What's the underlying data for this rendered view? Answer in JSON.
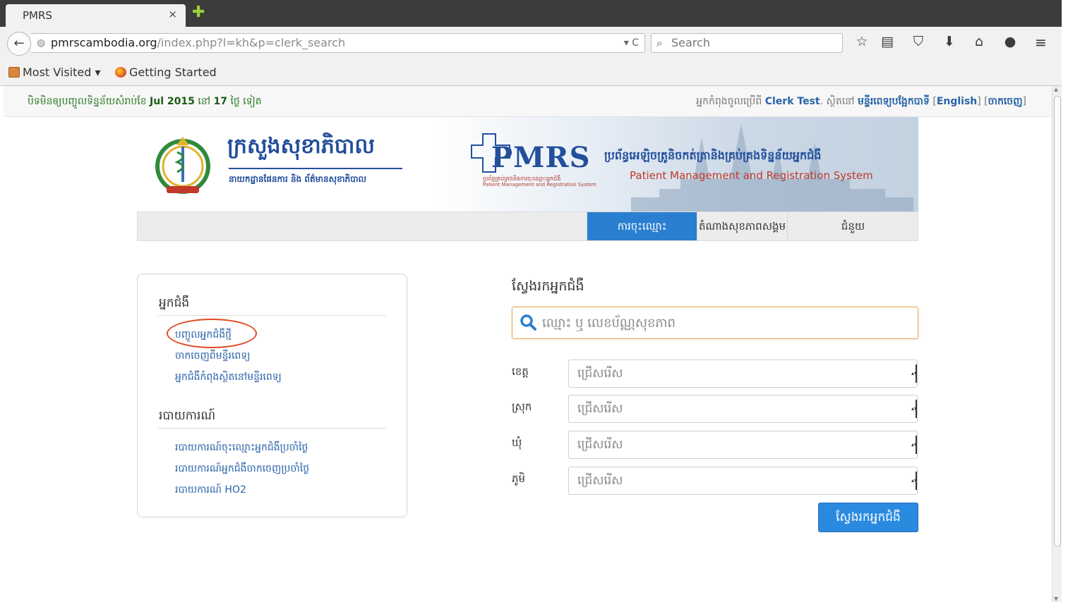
{
  "browser": {
    "tab_title": "PMRS",
    "tab_close": "×",
    "new_tab": "✚",
    "url_host": "pmrscambodia.org",
    "url_path": "/index.php?l=kh&p=clerk_search",
    "url_controls": "▾ C",
    "search_placeholder": "Search",
    "bookmarks": [
      {
        "label": "Most Visited ▾",
        "icon": "folder-icon"
      },
      {
        "label": "Getting Started",
        "icon": "firefox-icon"
      }
    ]
  },
  "topbar": {
    "notice_prefix": "បិទមិនឲ្យបញ្ចូលទិន្នន័យសំរាប់ខែ",
    "notice_month": "Jul 2015",
    "notice_mid": "នៅ",
    "notice_days": "17",
    "notice_suffix": "ថ្ងៃ ទៀត",
    "user_prefix": "អ្នកកំពុងចូលប្រើពី",
    "user_name": "Clerk Test",
    "user_mid": ". ស្ថិតនៅ",
    "hospital": "មន្ទីរពេទ្យបង្អែកបាទី",
    "lang_link": "English",
    "logout_link": "ចាកចេញ"
  },
  "header": {
    "ministry_title": "ក្រសួងសុខាភិបាល",
    "ministry_subtitle": "នាយកដ្ឋានផែនការ និង ព័ត៌មានសុខាភិបាល",
    "logo_text": "PMRS",
    "logo_small_kh": "ប្រព័ន្ធគ្រប់គ្រងនិងការចុះឈ្មោះអ្នកជំងឺ",
    "logo_small_en": "Patient Management and Registration System",
    "system_title_kh": "ប្រព័ន្ធអេឡិចត្រូនិចកត់ត្រានិងគ្រប់គ្រងទិន្នន័យអ្នកជំងឺ",
    "system_title_en": "Patient Management and Registration System"
  },
  "nav": [
    {
      "label": "ការចុះឈ្មោះ",
      "active": true
    },
    {
      "label": "តំណាងសុខភាពសង្គម",
      "active": false
    },
    {
      "label": "ជំនួយ",
      "active": false
    }
  ],
  "sidebar": {
    "patients_heading": "អ្នកជំងឺ",
    "patient_links": [
      "បញ្ចូលអ្នកជំងឺថ្មី",
      "ចាកចេញពីមន្ទីរពេទ្យ",
      "អ្នកជំងឺកំពុងស្ថិតនៅមន្ទីរពេទ្យ"
    ],
    "reports_heading": "របាយការណ៍",
    "report_links": [
      "របាយការណ៍ចុះឈ្មោះអ្នកជំងឺប្រចាំថ្ងៃ",
      "របាយការណ៍អ្នកជំងឺចាកចេញប្រចាំថ្ងៃ",
      "របាយការណ៍ HO2"
    ]
  },
  "search": {
    "title": "ស្វែងរកអ្នកជំងឺ",
    "placeholder": "ឈ្មោះ ឬ លេខប័ណ្ណសុខភាព",
    "fields": [
      {
        "label": "ខេត្ត",
        "value": "ជ្រើសរើស"
      },
      {
        "label": "ស្រុក",
        "value": "ជ្រើសរើស"
      },
      {
        "label": "ឃុំ",
        "value": "ជ្រើសរើស"
      },
      {
        "label": "ភូមិ",
        "value": "ជ្រើសរើស"
      }
    ],
    "button": "ស្វែងរកអ្នកជំងឺ"
  },
  "colors": {
    "brand_blue": "#234f9c",
    "nav_active": "#2a7fd0",
    "link": "#2a63a8",
    "notice_green": "#2c7a25",
    "highlight_circle": "#e04b24"
  }
}
